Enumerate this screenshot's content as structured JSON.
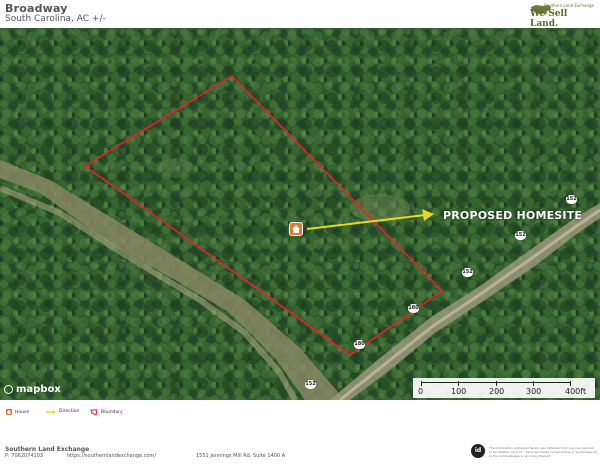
{
  "header": {
    "title": "Broadway",
    "subtitle": "South Carolina,  AC +/-",
    "brand_tagline": "Southern Land Exchange",
    "brand_name": "We Sell Land."
  },
  "map": {
    "annotation": "PROPOSED HOMESITE",
    "road_shields": [
      "152",
      "152",
      "152",
      "180",
      "180",
      "152"
    ],
    "boundary_color": "#e8202a",
    "arrow_color": "#e8d81f",
    "marker_color": "#e8742a",
    "attribution": "mapbox",
    "scale_labels": [
      "0",
      "100",
      "200",
      "300",
      "400ft"
    ]
  },
  "legend": {
    "items": [
      {
        "label": "House",
        "icon": "house-icon",
        "color": "#e8742a"
      },
      {
        "label": "Direction",
        "icon": "arrow-icon",
        "color": "#e8d81f"
      },
      {
        "label": "Boundary",
        "icon": "boundary-icon",
        "color": "#e8202a"
      }
    ]
  },
  "footer": {
    "company": "Southern Land Exchange",
    "phone": "P: 7062074103",
    "url": "https://southernlandexchange.com/",
    "address": "1551 Jennings Mill Rd, Suite 1400 A",
    "badge": "id",
    "disclaimer": "The information contained herein was obtained from sources deemed to be reliable. Land id™ Services makes no warranties or guarantees as to the completeness or accuracy thereof."
  }
}
